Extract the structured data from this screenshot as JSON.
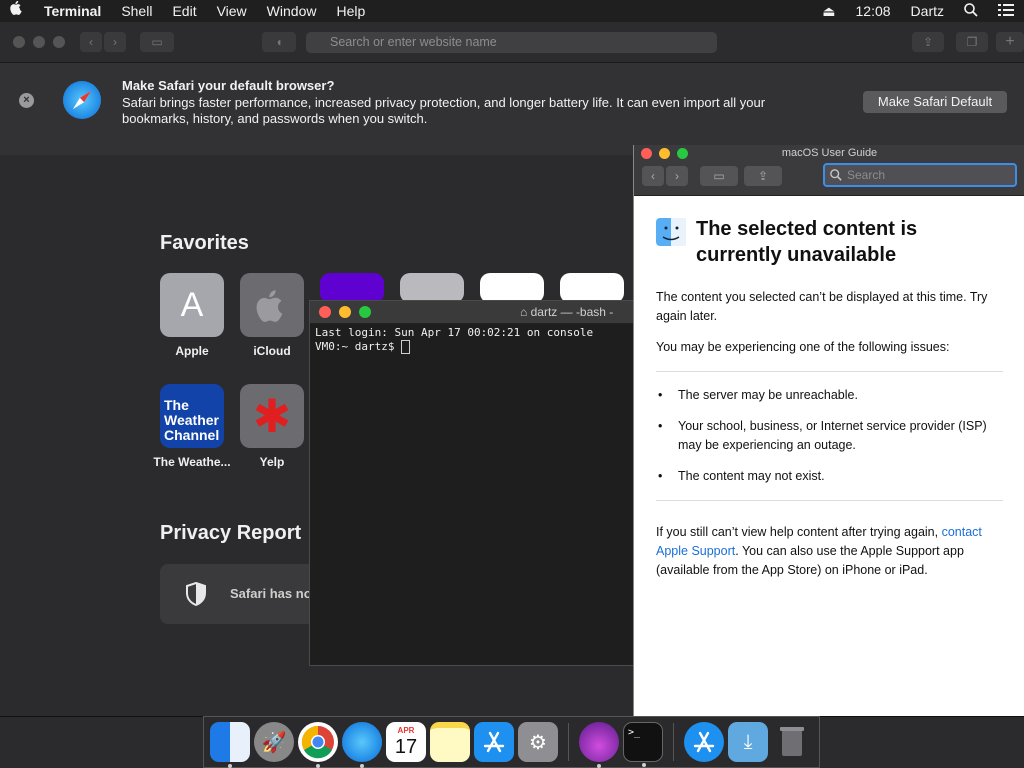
{
  "menubar": {
    "apple": "",
    "app": "Terminal",
    "items": [
      "Shell",
      "Edit",
      "View",
      "Window",
      "Help"
    ],
    "eject": "⏏",
    "time": "12:08",
    "user": "Dartz"
  },
  "safari": {
    "address_placeholder": "Search or enter website name",
    "banner": {
      "title": "Make Safari your default browser?",
      "text": "Safari brings faster performance, increased privacy protection, and longer battery life. It can even import all your bookmarks, history, and passwords when you switch.",
      "button": "Make Safari Default",
      "close": "×"
    },
    "favorites_title": "Favorites",
    "favorites": [
      {
        "label": "Apple",
        "glyph": "A"
      },
      {
        "label": "iCloud",
        "glyph": ""
      },
      {
        "label": "The Weathe...",
        "glyph": "The Weather Channel"
      },
      {
        "label": "Yelp",
        "glyph": "✱"
      }
    ],
    "privacy_title": "Privacy Report",
    "privacy_text": "Safari has no"
  },
  "terminal": {
    "title": "dartz — -bash -",
    "line1": "Last login: Sun Apr 17 00:02:21 on console",
    "prompt": "VM0:~ dartz$ "
  },
  "help": {
    "window_title": "macOS User Guide",
    "search_placeholder": "Search",
    "heading": "The selected content is currently unavailable",
    "p1": "The content you selected can’t be displayed at this time. Try again later.",
    "p2": "You may be experiencing one of the following issues:",
    "issues": [
      "The server may be unreachable.",
      "Your school, business, or Internet service provider (ISP) may be experiencing an outage.",
      "The content may not exist."
    ],
    "p3_before": "If you still can’t view help content after trying again, ",
    "p3_link": "contact Apple Support",
    "p3_after": ". You can also use the Apple Support app (available from the App Store) on iPhone or iPad."
  },
  "dock": {
    "calendar_month": "APR",
    "calendar_day": "17",
    "terminal_glyph": ">_"
  }
}
